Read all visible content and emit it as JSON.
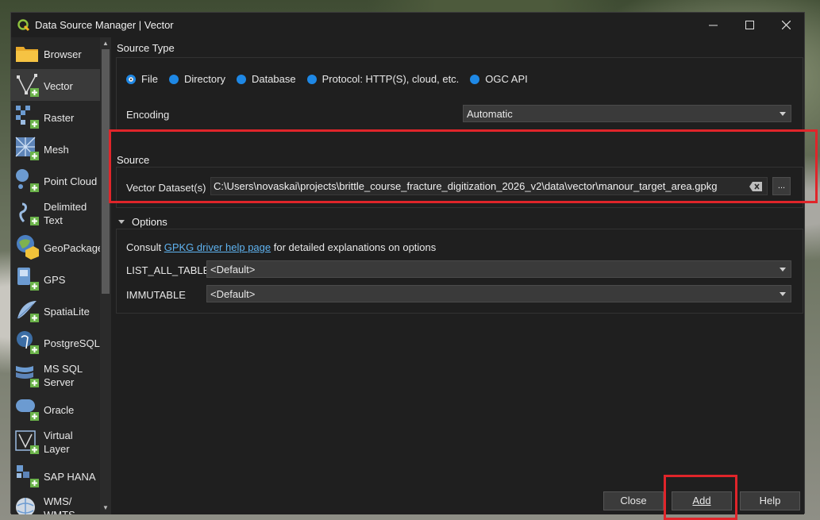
{
  "window": {
    "title": "Data Source Manager | Vector"
  },
  "sidebar": {
    "items": [
      {
        "label": "Browser",
        "icon": "folder-icon"
      },
      {
        "label": "Vector",
        "icon": "vector-layer-icon"
      },
      {
        "label": "Raster",
        "icon": "raster-layer-icon"
      },
      {
        "label": "Mesh",
        "icon": "mesh-layer-icon"
      },
      {
        "label": "Point Cloud",
        "icon": "point-cloud-icon"
      },
      {
        "label": "Delimited Text",
        "icon": "delimited-text-icon"
      },
      {
        "label": "GeoPackage",
        "icon": "geopackage-icon"
      },
      {
        "label": "GPS",
        "icon": "gps-icon"
      },
      {
        "label": "SpatiaLite",
        "icon": "spatialite-icon"
      },
      {
        "label": "PostgreSQL",
        "icon": "postgresql-icon"
      },
      {
        "label": "MS SQL Server",
        "icon": "mssql-icon"
      },
      {
        "label": "Oracle",
        "icon": "oracle-icon"
      },
      {
        "label": "Virtual Layer",
        "icon": "virtual-layer-icon"
      },
      {
        "label": "SAP HANA",
        "icon": "sap-hana-icon"
      },
      {
        "label": "WMS/ WMTS",
        "icon": "wms-icon"
      }
    ],
    "active_index": 1
  },
  "source_type": {
    "title": "Source Type",
    "options": [
      "File",
      "Directory",
      "Database",
      "Protocol: HTTP(S), cloud, etc.",
      "OGC API"
    ],
    "selected": "File",
    "encoding_label": "Encoding",
    "encoding_value": "Automatic"
  },
  "source": {
    "title": "Source",
    "dataset_label": "Vector Dataset(s)",
    "dataset_value": "C:\\Users\\novaskai\\projects\\brittle_course_fracture_digitization_2026_v2\\data\\vector\\manour_target_area.gpkg",
    "browse_label": "..."
  },
  "options": {
    "title": "Options",
    "consult_prefix": "Consult ",
    "consult_link": "GPKG driver help page",
    "consult_suffix": " for detailed explanations on options",
    "fields": [
      {
        "label": "LIST_ALL_TABLES",
        "value": "<Default>"
      },
      {
        "label": "IMMUTABLE",
        "value": "<Default>"
      }
    ]
  },
  "buttons": {
    "close": "Close",
    "add": "Add",
    "help": "Help"
  },
  "colors": {
    "accent": "#1e88e5",
    "highlight": "#e0252a",
    "link": "#5fb3f0"
  }
}
